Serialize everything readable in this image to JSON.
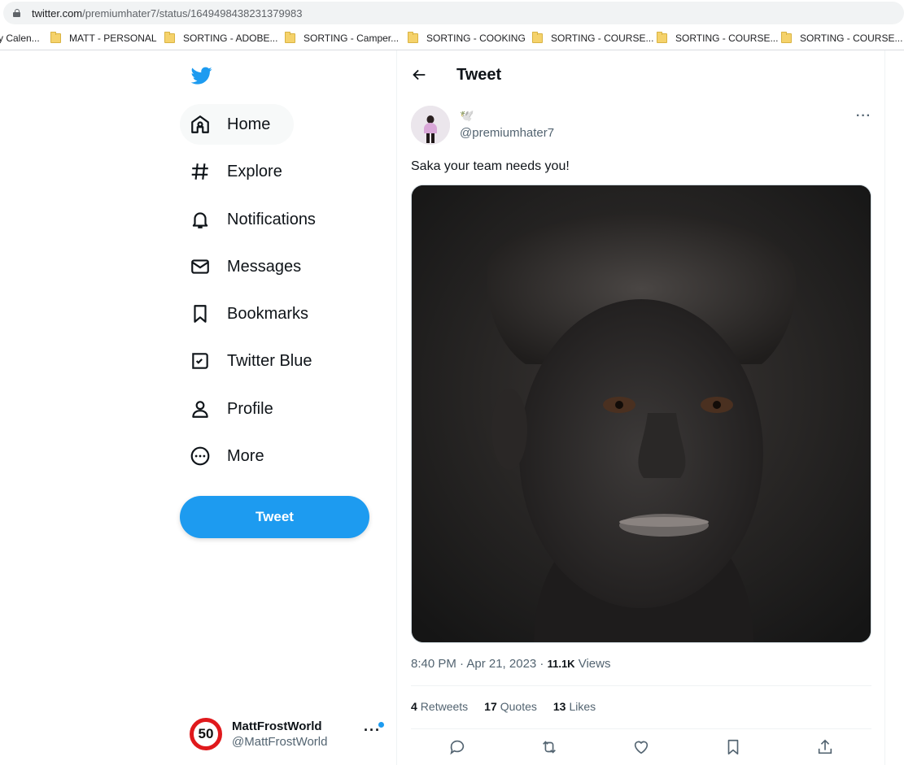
{
  "browser": {
    "url_host": "twitter.com",
    "url_path": "/premiumhater7/status/1649498438231379983",
    "bookmarks": [
      {
        "label": "y Calen..."
      },
      {
        "label": "MATT - PERSONAL"
      },
      {
        "label": "SORTING - ADOBE..."
      },
      {
        "label": "SORTING - Camper..."
      },
      {
        "label": "SORTING - COOKING"
      },
      {
        "label": "SORTING - COURSE..."
      },
      {
        "label": "SORTING - COURSE..."
      },
      {
        "label": "SORTING - COURSE..."
      }
    ]
  },
  "sidebar": {
    "items": [
      {
        "label": "Home",
        "icon": "home-icon"
      },
      {
        "label": "Explore",
        "icon": "hashtag-icon"
      },
      {
        "label": "Notifications",
        "icon": "bell-icon"
      },
      {
        "label": "Messages",
        "icon": "envelope-icon"
      },
      {
        "label": "Bookmarks",
        "icon": "bookmark-icon"
      },
      {
        "label": "Twitter Blue",
        "icon": "twitter-blue-icon"
      },
      {
        "label": "Profile",
        "icon": "person-icon"
      },
      {
        "label": "More",
        "icon": "more-circle-icon"
      }
    ],
    "tweet_button": "Tweet",
    "account": {
      "name": "MattFrostWorld",
      "handle": "@MattFrostWorld",
      "avatar_text": "50"
    }
  },
  "main": {
    "header_title": "Tweet",
    "tweet": {
      "display_name_emoji": "🕊️",
      "handle": "@premiumhater7",
      "text": "Saka your team needs you!",
      "time": "8:40 PM · Apr 21, 2023 · ",
      "views_count": "11.1K",
      "views_label": " Views",
      "retweets_count": "4",
      "retweets_label": "Retweets",
      "quotes_count": "17",
      "quotes_label": "Quotes",
      "likes_count": "13",
      "likes_label": "Likes"
    }
  },
  "colors": {
    "accent": "#1d9bf0",
    "text": "#0f1419",
    "secondary": "#536471"
  }
}
